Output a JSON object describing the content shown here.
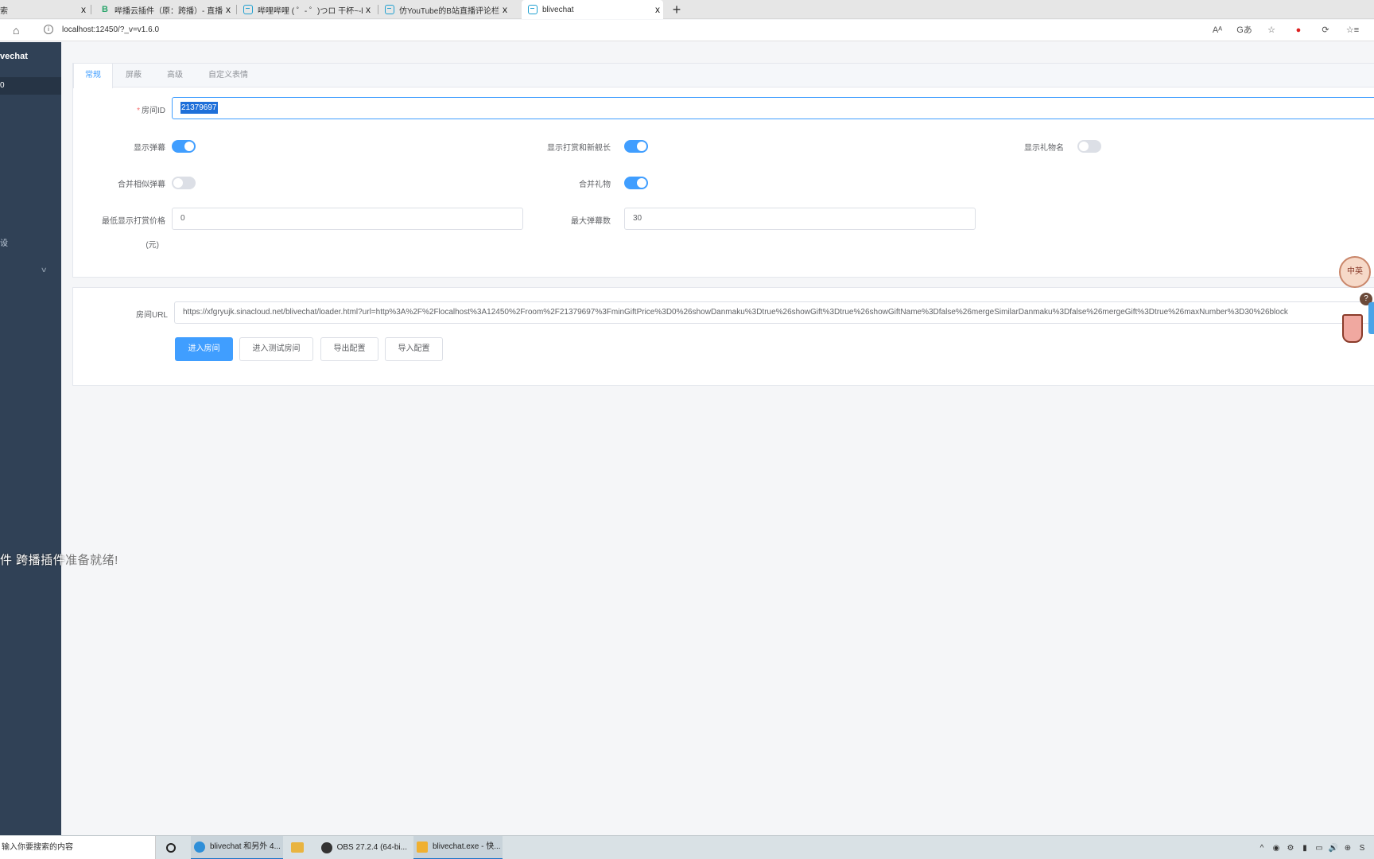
{
  "browser": {
    "tabs": [
      {
        "title": "索",
        "icon": "search-icon"
      },
      {
        "title": "哔播云插件（原：跨播）- 直播",
        "icon": "green-b-icon"
      },
      {
        "title": "哔哩哔哩 ( ゜- ゜)つロ 干杯~-bili",
        "icon": "bilibili-icon"
      },
      {
        "title": "仿YouTube的B站直播评论栏插件",
        "icon": "bilibili-icon"
      },
      {
        "title": "blivechat",
        "icon": "bilibili-icon"
      }
    ],
    "tab_close": "x",
    "new_tab": "+",
    "url": "localhost:12450/?_v=v1.6.0",
    "home_icon": "⌂",
    "info_icon": "i",
    "actions": [
      "Aᴬ",
      "Gあ",
      "☆",
      "●",
      "⟳",
      "☆≡"
    ]
  },
  "sidebar": {
    "title": "vechat",
    "sub": "0",
    "item": "设",
    "chevron": "∨"
  },
  "overlay": {
    "part_a": "件  跨播插件",
    "part_b": "准备就绪!"
  },
  "config": {
    "tabs": [
      "常规",
      "屏蔽",
      "高级",
      "自定义表情"
    ],
    "room_id": {
      "required_mark": "*",
      "label": "房间ID",
      "value": "21379697"
    },
    "switches": [
      {
        "label": "显示弹幕",
        "on": true
      },
      {
        "label": "显示打赏和新舰长",
        "on": true
      },
      {
        "label": "显示礼物名",
        "on": false
      },
      {
        "label": "合并相似弹幕",
        "on": false
      },
      {
        "label": "合并礼物",
        "on": true
      }
    ],
    "min_price": {
      "label": "最低显示打赏价格",
      "label2": "(元)",
      "value": "0"
    },
    "max_number": {
      "label": "最大弹幕数",
      "value": "30"
    }
  },
  "room_url": {
    "label": "房间URL",
    "value": "https://xfgryujk.sinacloud.net/blivechat/loader.html?url=http%3A%2F%2Flocalhost%3A12450%2Froom%2F21379697%3FminGiftPrice%3D0%26showDanmaku%3Dtrue%26showGift%3Dtrue%26showGiftName%3Dfalse%26mergeSimilarDanmaku%3Dfalse%26mergeGift%3Dtrue%26maxNumber%3D30%26block",
    "buttons": [
      "进入房间",
      "进入测试房间",
      "导出配置",
      "导入配置"
    ]
  },
  "widget": {
    "text_a": "中",
    "text_b": "英",
    "badge": "?"
  },
  "taskbar": {
    "search_placeholder": "输入你要搜索的内容",
    "apps": [
      {
        "label": "blivechat 和另外 4...",
        "color": "#2f8fd8"
      },
      {
        "label": "OBS 27.2.4 (64-bi...",
        "color": "#333333"
      },
      {
        "label": "blivechat.exe - 快...",
        "color": "#f0b030"
      }
    ],
    "tray": [
      "^",
      "◉",
      "⚙",
      "▮",
      "▭",
      "🔊",
      "⊕",
      "S"
    ]
  },
  "colors": {
    "primary": "#409eff",
    "sidebar": "#304156"
  }
}
